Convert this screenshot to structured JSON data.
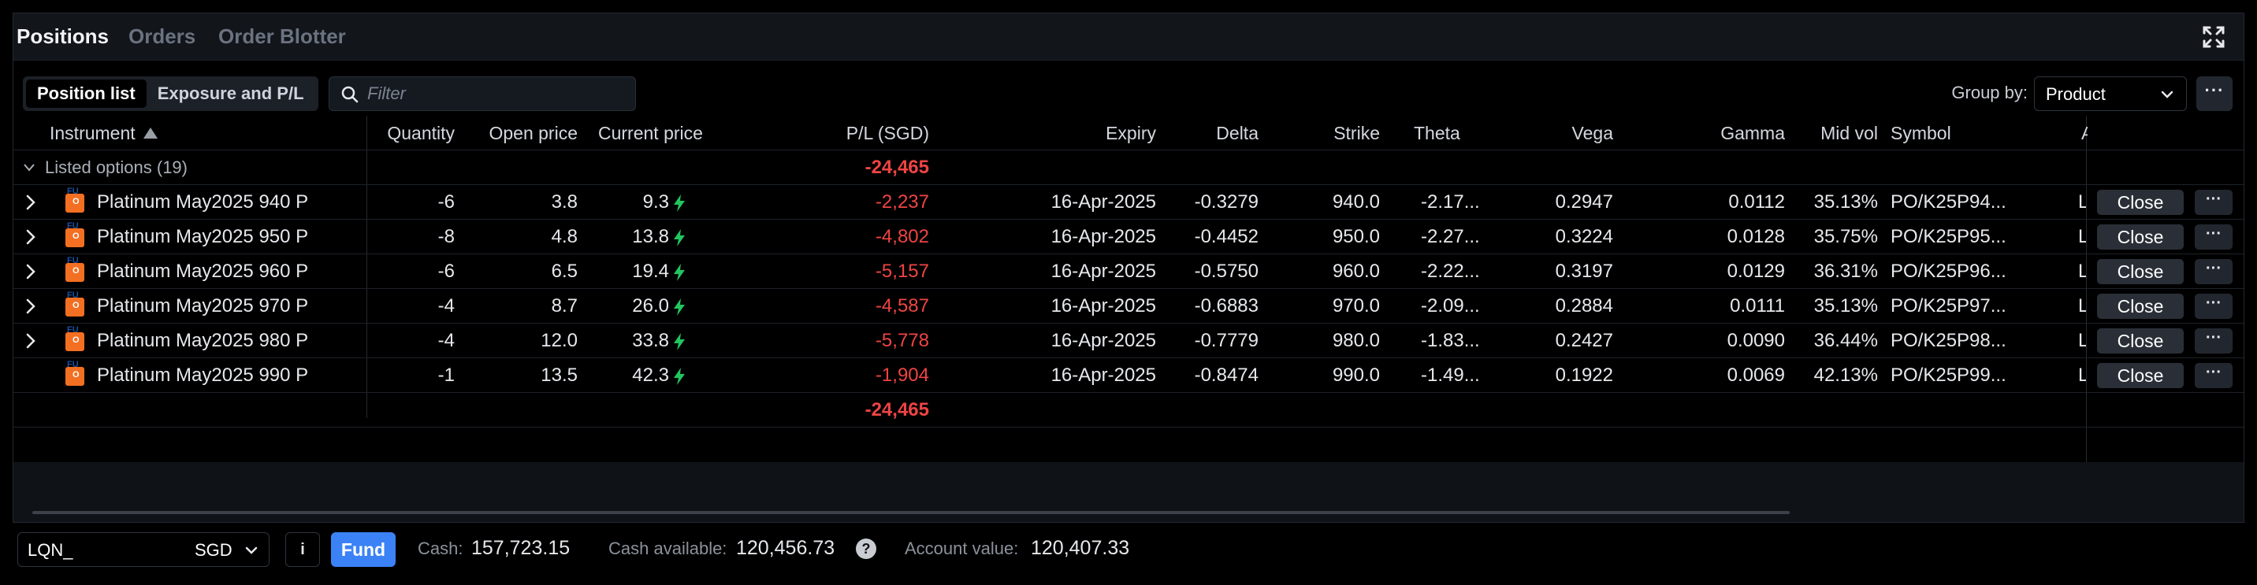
{
  "tabs": [
    "Positions",
    "Orders",
    "Order Blotter"
  ],
  "toolbar": {
    "views": [
      "Position list",
      "Exposure and P/L"
    ],
    "filter_placeholder": "Filter",
    "group_by_label": "Group by:",
    "group_by_value": "Product"
  },
  "columns": {
    "instrument": "Instrument",
    "quantity": "Quantity",
    "open_price": "Open price",
    "current_price": "Current price",
    "pl": "P/L (SGD)",
    "expiry": "Expiry",
    "delta": "Delta",
    "strike": "Strike",
    "theta": "Theta",
    "vega": "Vega",
    "gamma": "Gamma",
    "mid_vol": "Mid vol",
    "symbol": "Symbol",
    "extra": "A"
  },
  "group": {
    "label": "Listed options (19)",
    "pl_total": "-24,465"
  },
  "rows": [
    {
      "instrument": "Platinum May2025 940 P",
      "quantity": "-6",
      "open_price": "3.8",
      "current_price": "9.3",
      "pl": "-2,237",
      "expiry": "16-Apr-2025",
      "delta": "-0.3279",
      "strike": "940.0",
      "theta": "-2.17...",
      "vega": "0.2947",
      "gamma": "0.0112",
      "mid_vol": "35.13%",
      "symbol": "PO/K25P94...",
      "extra": "L",
      "close": "Close",
      "expandable": true
    },
    {
      "instrument": "Platinum May2025 950 P",
      "quantity": "-8",
      "open_price": "4.8",
      "current_price": "13.8",
      "pl": "-4,802",
      "expiry": "16-Apr-2025",
      "delta": "-0.4452",
      "strike": "950.0",
      "theta": "-2.27...",
      "vega": "0.3224",
      "gamma": "0.0128",
      "mid_vol": "35.75%",
      "symbol": "PO/K25P95...",
      "extra": "L",
      "close": "Close",
      "expandable": true
    },
    {
      "instrument": "Platinum May2025 960 P",
      "quantity": "-6",
      "open_price": "6.5",
      "current_price": "19.4",
      "pl": "-5,157",
      "expiry": "16-Apr-2025",
      "delta": "-0.5750",
      "strike": "960.0",
      "theta": "-2.22...",
      "vega": "0.3197",
      "gamma": "0.0129",
      "mid_vol": "36.31%",
      "symbol": "PO/K25P96...",
      "extra": "L",
      "close": "Close",
      "expandable": true
    },
    {
      "instrument": "Platinum May2025 970 P",
      "quantity": "-4",
      "open_price": "8.7",
      "current_price": "26.0",
      "pl": "-4,587",
      "expiry": "16-Apr-2025",
      "delta": "-0.6883",
      "strike": "970.0",
      "theta": "-2.09...",
      "vega": "0.2884",
      "gamma": "0.0111",
      "mid_vol": "35.13%",
      "symbol": "PO/K25P97...",
      "extra": "L",
      "close": "Close",
      "expandable": true
    },
    {
      "instrument": "Platinum May2025 980 P",
      "quantity": "-4",
      "open_price": "12.0",
      "current_price": "33.8",
      "pl": "-5,778",
      "expiry": "16-Apr-2025",
      "delta": "-0.7779",
      "strike": "980.0",
      "theta": "-1.83...",
      "vega": "0.2427",
      "gamma": "0.0090",
      "mid_vol": "36.44%",
      "symbol": "PO/K25P98...",
      "extra": "L",
      "close": "Close",
      "expandable": true
    },
    {
      "instrument": "Platinum May2025 990 P",
      "quantity": "-1",
      "open_price": "13.5",
      "current_price": "42.3",
      "pl": "-1,904",
      "expiry": "16-Apr-2025",
      "delta": "-0.8474",
      "strike": "990.0",
      "theta": "-1.49...",
      "vega": "0.1922",
      "gamma": "0.0069",
      "mid_vol": "42.13%",
      "symbol": "PO/K25P99...",
      "extra": "L",
      "close": "Close",
      "expandable": false
    }
  ],
  "total": {
    "pl": "-24,465"
  },
  "footer": {
    "account": "LQN_",
    "currency": "SGD",
    "info": "i",
    "fund": "Fund",
    "cash_label": "Cash:",
    "cash_value": "157,723.15",
    "cash_available_label": "Cash available:",
    "cash_available_value": "120,456.73",
    "help": "?",
    "account_value_label": "Account value:",
    "account_value_value": "120,407.33"
  },
  "colors": {
    "negative": "#ef4444",
    "accent": "#3b82f6",
    "bolt": "#22c55e",
    "product_badge": "#f36f21"
  }
}
